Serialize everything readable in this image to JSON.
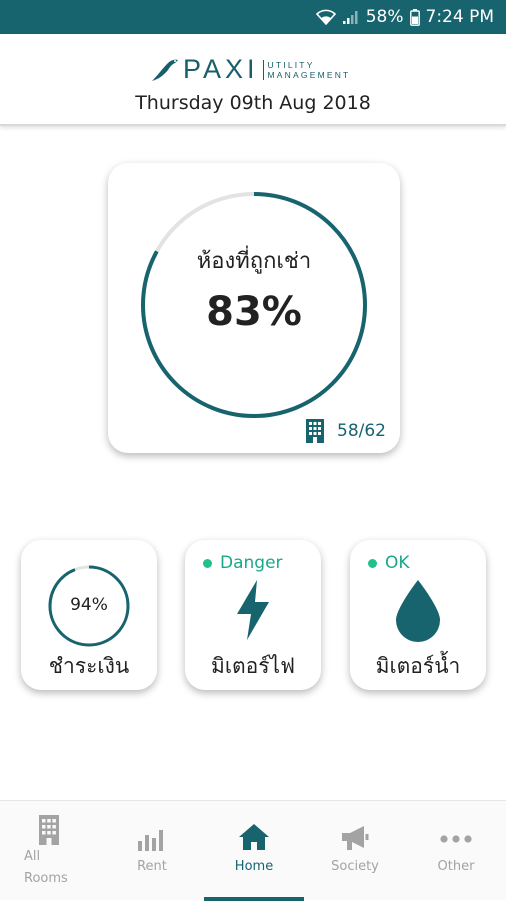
{
  "status_bar": {
    "battery": "58%",
    "time": "7:24 PM"
  },
  "header": {
    "logo_main": "PAXI",
    "logo_sub_1": "UTILITY",
    "logo_sub_2": "MANAGEMENT",
    "date": "Thursday 09th Aug 2018"
  },
  "occupancy": {
    "title": "ห้องที่ถูกเช่า",
    "percent": "83%",
    "percent_value": 0.83,
    "count": "58/62"
  },
  "cards": {
    "payment": {
      "percent": "94%",
      "percent_value": 0.94,
      "label": "ชำระเงิน"
    },
    "electric": {
      "status": "Danger",
      "label": "มิเตอร์ไฟ"
    },
    "water": {
      "status": "OK",
      "label": "มิเตอร์น้ำ"
    }
  },
  "nav": {
    "all_rooms_1": "All",
    "all_rooms_2": "Rooms",
    "rent": "Rent",
    "home": "Home",
    "society": "Society",
    "other": "Other"
  },
  "colors": {
    "primary": "#17646f",
    "ok": "#22c08a",
    "ring_track": "#e3e3e3"
  }
}
